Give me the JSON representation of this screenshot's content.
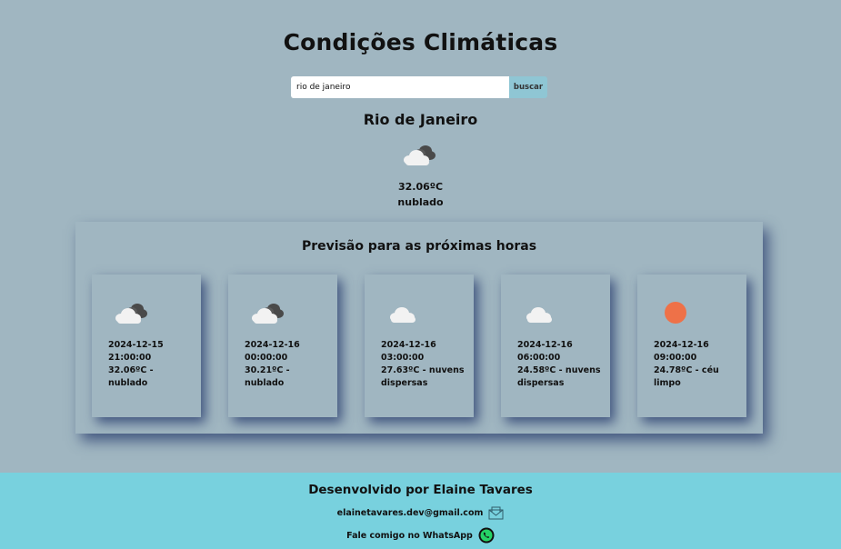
{
  "header": {
    "title": "Condições Climáticas"
  },
  "search": {
    "value": "rio de janeiro",
    "button_label": "buscar"
  },
  "current": {
    "city": "Rio de Janeiro",
    "icon": "broken-clouds-icon",
    "temperature": "32.06ºC",
    "description": "nublado"
  },
  "forecast": {
    "title": "Previsão para as próximas horas",
    "items": [
      {
        "datetime": "2024-12-15 21:00:00",
        "summary": "32.06ºC - nublado",
        "icon": "broken-clouds-icon"
      },
      {
        "datetime": "2024-12-16 00:00:00",
        "summary": "30.21ºC - nublado",
        "icon": "broken-clouds-icon"
      },
      {
        "datetime": "2024-12-16 03:00:00",
        "summary": "27.63ºC - nuvens dispersas",
        "icon": "scattered-clouds-icon"
      },
      {
        "datetime": "2024-12-16 06:00:00",
        "summary": "24.58ºC - nuvens dispersas",
        "icon": "scattered-clouds-icon"
      },
      {
        "datetime": "2024-12-16 09:00:00",
        "summary": "24.78ºC - céu limpo",
        "icon": "clear-sky-sun-icon"
      }
    ]
  },
  "footer": {
    "credit": "Desenvolvido por Elaine Tavares",
    "email": "elainetavares.dev@gmail.com",
    "whatsapp": "Fale comigo no WhatsApp",
    "email_icon": "mail-icon",
    "whatsapp_icon": "whatsapp-icon"
  },
  "colors": {
    "background": "#a0b6c1",
    "footer": "#78d1de",
    "button": "#8fc6d4",
    "sun": "#ee7148",
    "whatsapp": "#25d366"
  }
}
